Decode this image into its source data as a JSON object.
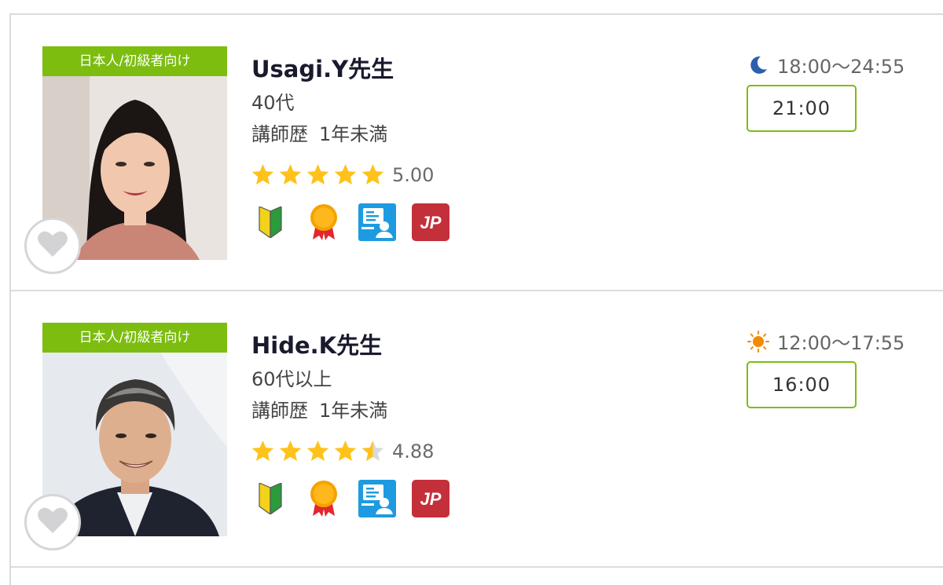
{
  "colors": {
    "accent_green": "#7cbd10",
    "star": "#ffc21a",
    "star_empty": "#d9d9d9",
    "jp_red": "#c4303a",
    "blue": "#1e9be0"
  },
  "teachers": [
    {
      "label": "日本人/初級者向け",
      "name": "Usagi.Y先生",
      "age": "40代",
      "career_label": "講師歴",
      "career_value": "1年未満",
      "rating": 5.0,
      "rating_text": "5.00",
      "time_icon": "moon-icon",
      "time_range": "18:00〜24:55",
      "slot": "21:00",
      "badges": [
        "beginner-mark-icon",
        "medal-icon",
        "online-lesson-icon",
        "jp-icon"
      ],
      "jp_text": "JP"
    },
    {
      "label": "日本人/初級者向け",
      "name": "Hide.K先生",
      "age": "60代以上",
      "career_label": "講師歴",
      "career_value": "1年未満",
      "rating": 4.88,
      "rating_text": "4.88",
      "time_icon": "sun-icon",
      "time_range": "12:00〜17:55",
      "slot": "16:00",
      "badges": [
        "beginner-mark-icon",
        "medal-icon",
        "online-lesson-icon",
        "jp-icon"
      ],
      "jp_text": "JP"
    }
  ]
}
